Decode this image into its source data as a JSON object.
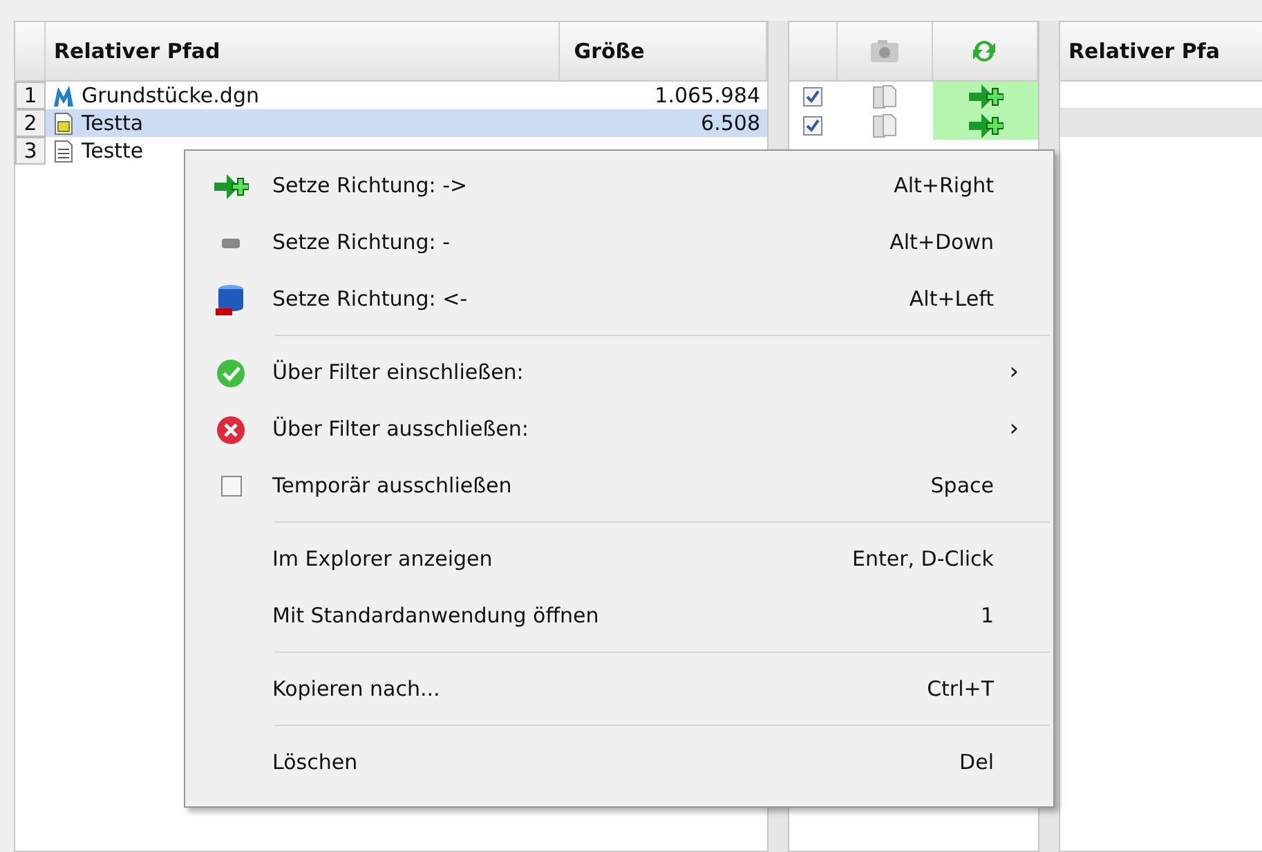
{
  "left_table": {
    "columns": [
      "Relativer Pfad",
      "Größe"
    ],
    "rows": [
      {
        "number": "1",
        "name": "Grundstücke.dgn",
        "size": "1.065.984",
        "kind": "drawing",
        "selected": false
      },
      {
        "number": "2",
        "name": "Testta",
        "size": "6.508",
        "kind": "sheet",
        "selected": true
      },
      {
        "number": "3",
        "name": "Testte",
        "kind": "text",
        "selected": false
      }
    ]
  },
  "sync_table": {
    "rows": [
      {
        "checked": true
      },
      {
        "checked": true
      }
    ]
  },
  "right_table": {
    "columns": [
      "Relativer Pfa"
    ],
    "rows": [
      {
        "selected": false
      },
      {
        "selected": true
      }
    ]
  },
  "context_menu": {
    "groups": [
      {
        "items": [
          {
            "label": "Setze Richtung: ->",
            "shortcut": "Alt+Right",
            "kind": "add"
          },
          {
            "label": "Setze Richtung: -",
            "shortcut": "Alt+Down",
            "kind": "neutral"
          },
          {
            "label": "Setze Richtung: <-",
            "shortcut": "Alt+Left",
            "kind": "remove"
          }
        ]
      },
      {
        "items": [
          {
            "label": "Über Filter einschließen:",
            "kind": "include",
            "submenu": "›"
          },
          {
            "label": "Über Filter ausschließen:",
            "kind": "exclude",
            "submenu": "›"
          },
          {
            "label": "Temporär ausschließen",
            "shortcut": "Space",
            "kind": "toggle",
            "checked": false
          }
        ]
      },
      {
        "items": [
          {
            "label": "Im Explorer anzeigen",
            "shortcut": "Enter, D-Click"
          },
          {
            "label": "Mit Standardanwendung öffnen",
            "shortcut": "1"
          }
        ]
      },
      {
        "items": [
          {
            "label": "Kopieren nach...",
            "shortcut": "Ctrl+T"
          }
        ]
      },
      {
        "items": [
          {
            "label": "Löschen",
            "shortcut": "Del"
          }
        ]
      }
    ]
  }
}
